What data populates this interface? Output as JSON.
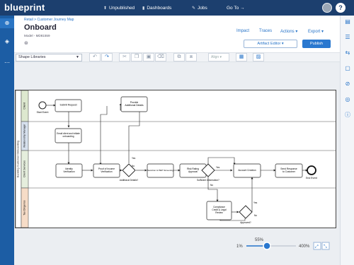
{
  "topbar": {
    "logo": "blueprint",
    "nav": [
      {
        "icon": "upload-icon",
        "label": "Unpublished"
      },
      {
        "icon": "bar-chart-icon",
        "label": "Dashboards"
      },
      {
        "icon": "wrench-icon",
        "label": "Jobs"
      },
      {
        "icon": "arrow-right-icon",
        "label": "Go To →"
      }
    ],
    "help": "?"
  },
  "header": {
    "breadcrumb": "Retail > Customer Journey Map",
    "title": "Onboard",
    "model": "Model - MD81559",
    "links": [
      "Impact",
      "Traces",
      "Actions ▾",
      "Export ▾"
    ],
    "artifact_editor": "Artifact Editor ▾",
    "publish": "Publish"
  },
  "toolbar": {
    "shape_libraries": "Shape Libraries",
    "align": "Align ▾"
  },
  "diagram": {
    "pool": "Banking Customer Onboarding",
    "lanes": [
      "Client",
      "Relationship Manager",
      "Client Services",
      "Tax Diligence"
    ],
    "nodes": {
      "start": "Start Event",
      "submit": "Submit Request",
      "email": [
        "Email client and initiate",
        "onboarding"
      ],
      "provide": [
        "Provide",
        "Additional Details"
      ],
      "identity": [
        "Identity",
        "Verification"
      ],
      "proof": [
        "Proof of Income",
        "Verification"
      ],
      "sanction": "Sanction & PEP Screening",
      "risk": [
        "Risk Rating",
        "Approval"
      ],
      "account": "Account Creation",
      "welcome": [
        "Send Response",
        "to Customer"
      ],
      "end": "End Event",
      "compliance": [
        "Compliance",
        "Credit & Legal",
        "Review"
      ]
    },
    "gateways": {
      "g1": "Additional Details?",
      "g2": "Sufficient Information?",
      "g3": "Approved?"
    },
    "edge_labels": {
      "yes1": "Yes",
      "no1": "No",
      "yes2": "Yes",
      "no2": "No",
      "yes3": "Yes",
      "no3": "No"
    }
  },
  "zoom": {
    "percent": "55%",
    "min": "1%",
    "max": "400%",
    "value": 55
  }
}
